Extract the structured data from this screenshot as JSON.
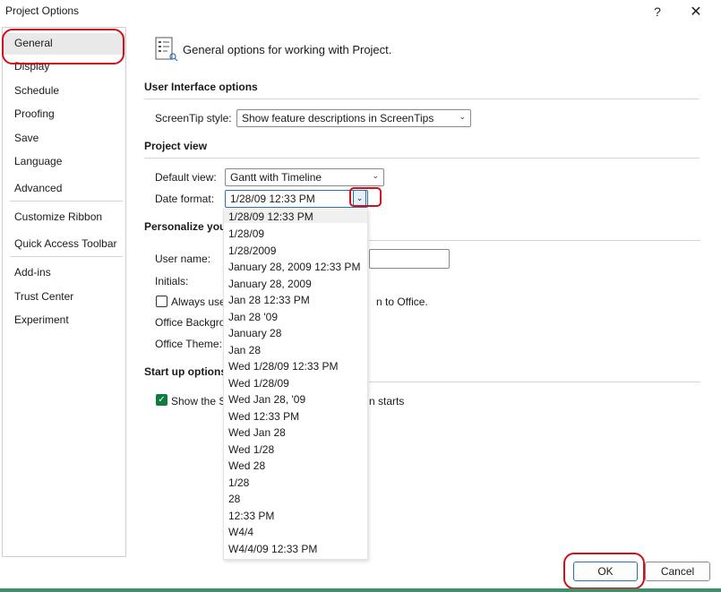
{
  "window": {
    "title": "Project Options",
    "help": "?",
    "close": "✕"
  },
  "sidebar": {
    "items": [
      {
        "label": "General"
      },
      {
        "label": "Display"
      },
      {
        "label": "Schedule"
      },
      {
        "label": "Proofing"
      },
      {
        "label": "Save"
      },
      {
        "label": "Language"
      },
      {
        "label": "Advanced"
      },
      {
        "label": "Customize Ribbon"
      },
      {
        "label": "Quick Access Toolbar"
      },
      {
        "label": "Add-ins"
      },
      {
        "label": "Trust Center"
      },
      {
        "label": "Experiment"
      }
    ]
  },
  "main": {
    "header": "General options for working with Project.",
    "ui_section": "User Interface options",
    "screentip_label": "ScreenTip style:",
    "screentip_value": "Show feature descriptions in ScreenTips",
    "project_view_section": "Project view",
    "default_view_label": "Default view:",
    "default_view_value": "Gantt with Timeline",
    "date_format_label": "Date format:",
    "date_format_value": "1/28/09 12:33 PM",
    "personalize_section": "Personalize your",
    "user_name_label": "User name:",
    "initials_label": "Initials:",
    "always_use_text": "Always use",
    "always_use_tail": "n to Office.",
    "office_background_label": "Office Backgro",
    "office_theme_label": "Office Theme:",
    "startup_section": "Start up options",
    "show_start_text": "Show the St",
    "show_start_tail": "n starts"
  },
  "date_format_options": [
    "1/28/09 12:33 PM",
    "1/28/09",
    "1/28/2009",
    "January 28, 2009 12:33 PM",
    "January 28, 2009",
    "Jan 28 12:33 PM",
    "Jan 28 '09",
    "January 28",
    "Jan 28",
    "Wed 1/28/09 12:33 PM",
    "Wed 1/28/09",
    "Wed Jan 28, '09",
    "Wed 12:33 PM",
    "Wed Jan 28",
    "Wed 1/28",
    "Wed 28",
    "1/28",
    "28",
    "12:33 PM",
    "W4/4",
    "W4/4/09 12:33 PM"
  ],
  "buttons": {
    "ok": "OK",
    "cancel": "Cancel"
  },
  "colors": {
    "highlight": "#d0101a",
    "accent": "#0f7b3f"
  }
}
